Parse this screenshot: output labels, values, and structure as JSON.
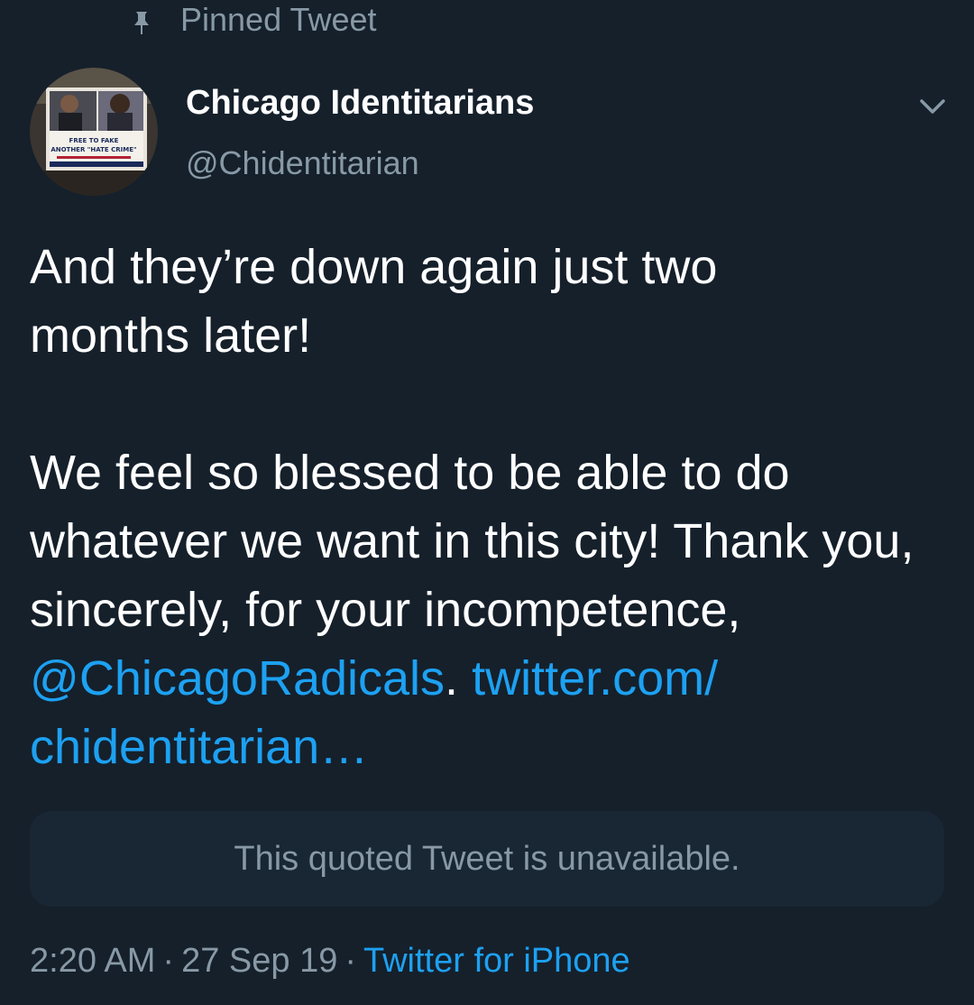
{
  "pinned": {
    "label": "Pinned Tweet",
    "icon": "pin-icon"
  },
  "author": {
    "name": "Chicago Identitarians",
    "handle": "@Chidentitarian",
    "avatar_text": {
      "line1": "FREE TO FAKE",
      "line2": "ANOTHER \"HATE CRIME\""
    },
    "menu_icon": "chevron-down-icon"
  },
  "tweet": {
    "line1": "And they’re down again just two",
    "line2": "months later!",
    "para2_text": "We feel so blessed to be able to do whatever we want in this city! Thank you, sincerely, for your incompetence,",
    "mention": "@ChicagoRadicals",
    "period": ".",
    "url_part1": "twitter.com/",
    "url_part2": "chidentitarian…"
  },
  "quote": {
    "unavailable_text": "This quoted Tweet is unavailable."
  },
  "meta": {
    "time": "2:20 AM",
    "dot": "·",
    "date": "27 Sep 19",
    "source": "Twitter for iPhone"
  },
  "colors": {
    "background": "#15202b",
    "link": "#1da1f2",
    "secondary_text": "#8899a6"
  }
}
